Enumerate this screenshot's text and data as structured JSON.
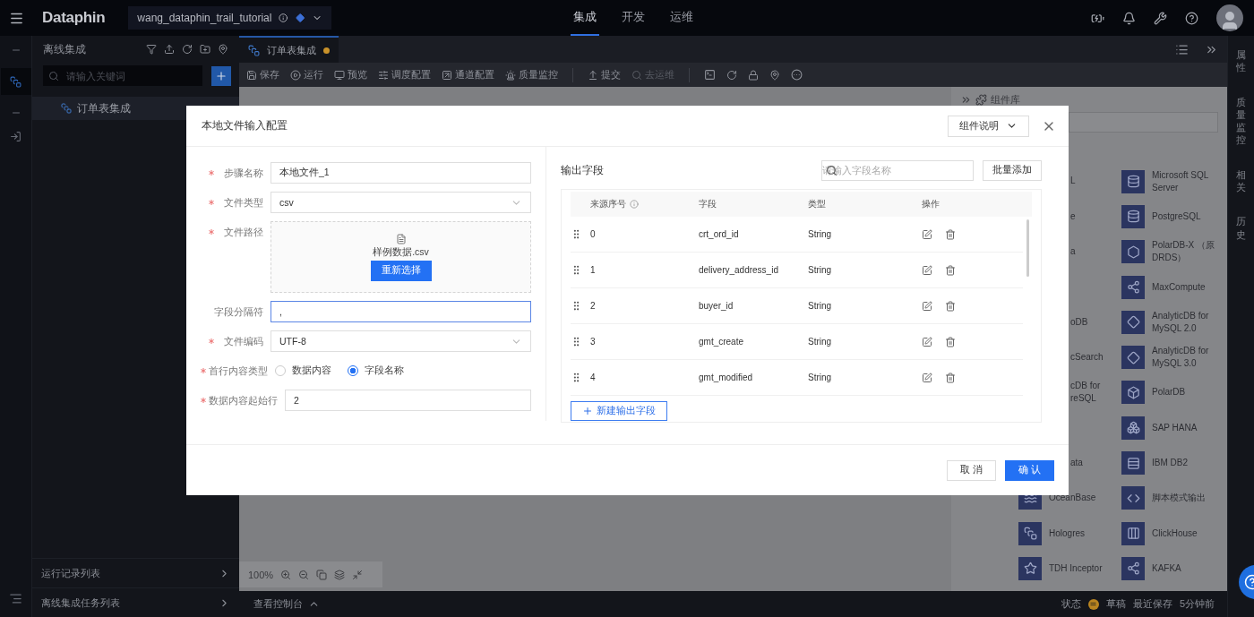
{
  "topbar": {
    "logo": "Dataphin",
    "project": "wang_dataphin_trail_tutorial",
    "nav": [
      {
        "label": "集成",
        "selected": true
      },
      {
        "label": "开发",
        "selected": false
      },
      {
        "label": "运维",
        "selected": false
      }
    ]
  },
  "sidebar": {
    "title": "离线集成",
    "search": {
      "placeholder": "请输入关键词"
    },
    "items": [
      {
        "label": "订单表集成",
        "selected": true
      }
    ],
    "footer": [
      "运行记录列表",
      "离线集成任务列表"
    ]
  },
  "tabs": [
    {
      "label": "订单表集成",
      "selected": true,
      "unsaved": true
    }
  ],
  "toolbar": [
    {
      "label": "保存",
      "disabled": false
    },
    {
      "label": "运行",
      "disabled": false
    },
    {
      "label": "预览",
      "disabled": false
    },
    {
      "label": "调度配置",
      "disabled": false
    },
    {
      "label": "通道配置",
      "disabled": false
    },
    {
      "label": "质量监控",
      "disabled": false
    },
    {
      "label": "提交",
      "disabled": false
    },
    {
      "label": "去运维",
      "disabled": true
    }
  ],
  "component_library": {
    "title": "组件库",
    "rows": [
      {
        "left": {
          "name": "L",
          "covered": true
        },
        "right": {
          "name": "Microsoft SQL Server"
        }
      },
      {
        "left": {
          "name": "e",
          "covered": true
        },
        "right": {
          "name": "PostgreSQL"
        }
      },
      {
        "left": {
          "name": "a",
          "covered": true
        },
        "right": {
          "name": "PolarDB-X （原DRDS）"
        }
      },
      {
        "right": {
          "name": "MaxCompute"
        }
      },
      {
        "left": {
          "name": "oDB",
          "covered": true
        },
        "right": {
          "name": "AnalyticDB for MySQL 2.0"
        }
      },
      {
        "left": {
          "name": "cSearch",
          "covered": true
        },
        "right": {
          "name": "AnalyticDB for MySQL 3.0"
        }
      },
      {
        "left": {
          "name": "cDB for reSQL",
          "covered": true
        },
        "right": {
          "name": "PolarDB"
        }
      },
      {
        "right": {
          "name": "SAP HANA"
        }
      },
      {
        "left": {
          "name": "ata",
          "covered": true
        },
        "right": {
          "name": "IBM DB2"
        }
      },
      {
        "left": {
          "name": "OceanBase",
          "covered": false
        },
        "right": {
          "name": "脚本模式输出"
        }
      },
      {
        "left": {
          "name": "Hologres",
          "covered": false
        },
        "right": {
          "name": "ClickHouse"
        }
      },
      {
        "left": {
          "name": "TDH Inceptor",
          "covered": false
        },
        "right": {
          "name": "KAFKA"
        }
      }
    ]
  },
  "right_rail": [
    "属性",
    "质量监控",
    "相关",
    "历史"
  ],
  "zoom": "100%",
  "console": "查看控制台",
  "status": {
    "label": "状态",
    "value": "草稿",
    "saved_label": "最近保存",
    "saved_time": "5分钟前"
  },
  "modal": {
    "title": "本地文件输入配置",
    "help": "组件说明",
    "form": [
      {
        "kind": "input",
        "label": "步骤名称",
        "required": true,
        "value": "本地文件_1",
        "focused": false
      },
      {
        "kind": "select",
        "label": "文件类型",
        "required": true,
        "value": "csv"
      },
      {
        "kind": "upload",
        "label": "文件路径",
        "required": true,
        "file": "样例数据.csv",
        "button": "重新选择"
      },
      {
        "kind": "input",
        "label": "字段分隔符",
        "required": false,
        "value": ",",
        "focused": true
      },
      {
        "kind": "select",
        "label": "文件编码",
        "required": true,
        "value": "UTF-8"
      },
      {
        "kind": "radio",
        "label": "首行内容类型",
        "required": true,
        "options": [
          {
            "label": "数据内容",
            "selected": false
          },
          {
            "label": "字段名称",
            "selected": true
          }
        ]
      },
      {
        "kind": "input",
        "label": "数据内容起始行",
        "required": true,
        "value": "2",
        "focused": false
      }
    ],
    "output": {
      "title": "输出字段",
      "search": {
        "placeholder": "请输入字段名称"
      },
      "batch_button": "批量添加",
      "columns": [
        {
          "label": "来源序号",
          "info": true
        },
        {
          "label": "字段",
          "info": false
        },
        {
          "label": "类型",
          "info": false
        },
        {
          "label": "操作",
          "info": false
        }
      ],
      "rows": [
        {
          "index": "0",
          "field": "crt_ord_id",
          "type": "String"
        },
        {
          "index": "1",
          "field": "delivery_address_id",
          "type": "String"
        },
        {
          "index": "2",
          "field": "buyer_id",
          "type": "String"
        },
        {
          "index": "3",
          "field": "gmt_create",
          "type": "String"
        },
        {
          "index": "4",
          "field": "gmt_modified",
          "type": "String"
        }
      ],
      "add_button": "新建输出字段"
    },
    "buttons": [
      "取 消",
      "确 认"
    ]
  }
}
